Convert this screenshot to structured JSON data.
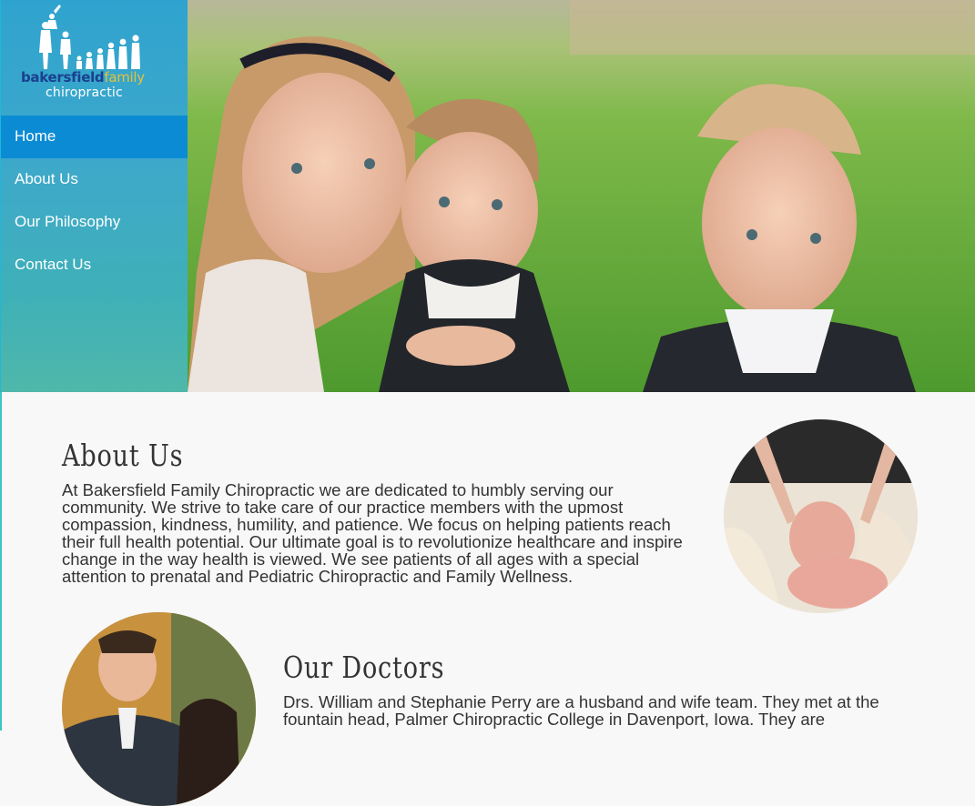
{
  "logo": {
    "brand_word1": "bakersfield",
    "brand_word2": "family",
    "brand_line2": "chiropractic"
  },
  "nav": {
    "items": [
      {
        "label": "Home",
        "active": true
      },
      {
        "label": "About Us",
        "active": false
      },
      {
        "label": "Our Philosophy",
        "active": false
      },
      {
        "label": "Contact Us",
        "active": false
      }
    ]
  },
  "about": {
    "title": "About Us",
    "body": "At Bakersfield Family Chiropractic we are dedicated to humbly serving our community. We strive to take care of our practice members with the upmost compassion, kindness, humility, and patience. We focus on helping patients reach their full health potential. Our ultimate goal is to revolutionize healthcare and inspire change in the way health is viewed. We see patients of all ages with a special attention to prenatal and Pediatric Chiropractic and Family Wellness."
  },
  "doctors": {
    "title": "Our Doctors",
    "body": "Drs. William and Stephanie Perry are a husband and wife team. They met at the fountain head, Palmer Chiropractic College in Davenport, Iowa. They are"
  },
  "colors": {
    "nav_active": "#0b8bd4",
    "sidebar_top": "#2fa3cf",
    "accent_border": "#39c6c3",
    "logo_blue": "#1b3f8f",
    "logo_gold": "#e5c13a"
  }
}
